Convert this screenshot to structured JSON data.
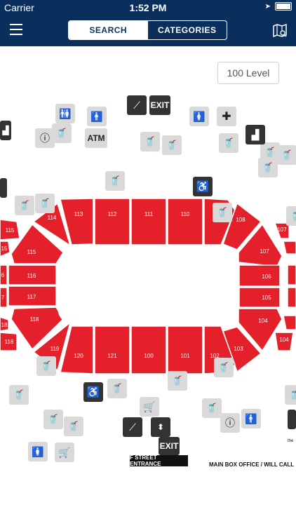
{
  "status": {
    "carrier": "Carrier",
    "time": "1:52 PM"
  },
  "nav": {
    "search_tab": "SEARCH",
    "categories_tab": "CATEGORIES"
  },
  "level_button": "100 Level",
  "sections": [
    "113",
    "112",
    "111",
    "110",
    "108",
    "107",
    "106",
    "105",
    "104",
    "103",
    "102",
    "101",
    "100",
    "121",
    "120",
    "119",
    "118",
    "117",
    "116",
    "115",
    "114"
  ],
  "edge_sections": {
    "left_115": "115",
    "left_18": "18",
    "left_118": "118",
    "left_7": "7",
    "left_6": "6",
    "left_15": "15",
    "right_107": "107",
    "right_104": "104"
  },
  "labels": {
    "exit": "EXIT",
    "atm": "ATM",
    "f_street": "F STREET ENTRANCE",
    "box_office": "MAIN BOX OFFICE / WILL CALL",
    "the": "the"
  },
  "colors": {
    "nav": "#0a2f5c",
    "section": "#e4202a",
    "icon_light": "#d9d9d9",
    "icon_dark": "#333333"
  }
}
